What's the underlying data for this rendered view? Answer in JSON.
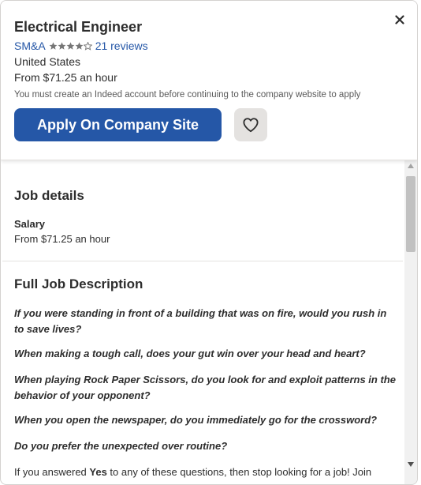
{
  "header": {
    "job_title": "Electrical Engineer",
    "company": "SM&A",
    "rating": 4,
    "rating_max": 5,
    "reviews": "21 reviews",
    "location": "United States",
    "salary": "From $71.25 an hour",
    "notice": "You must create an Indeed account before continuing to the company website to apply",
    "apply_label": "Apply On Company Site",
    "close_icon": "close-icon",
    "save_icon": "heart-icon"
  },
  "job_details": {
    "heading": "Job details",
    "salary_label": "Salary",
    "salary_value": "From $71.25 an hour"
  },
  "description": {
    "heading": "Full Job Description",
    "questions": [
      "If you were standing in front of a building that was on fire, would you rush in to save lives?",
      "When making a tough call, does your gut win over your head and heart?",
      "When playing Rock Paper Scissors, do you look for and exploit patterns in the behavior of your opponent?",
      "When you open the newspaper, do you immediately go for the crossword?",
      "Do you prefer the unexpected over routine?"
    ],
    "closing_prefix": "If you answered ",
    "closing_bold": "Yes",
    "closing_suffix": " to any of these questions, then stop looking for a job! Join"
  },
  "colors": {
    "accent": "#2557a7",
    "text": "#2d2d2d",
    "muted": "#595959",
    "star": "#767676",
    "save_bg": "#e4e2e0"
  }
}
